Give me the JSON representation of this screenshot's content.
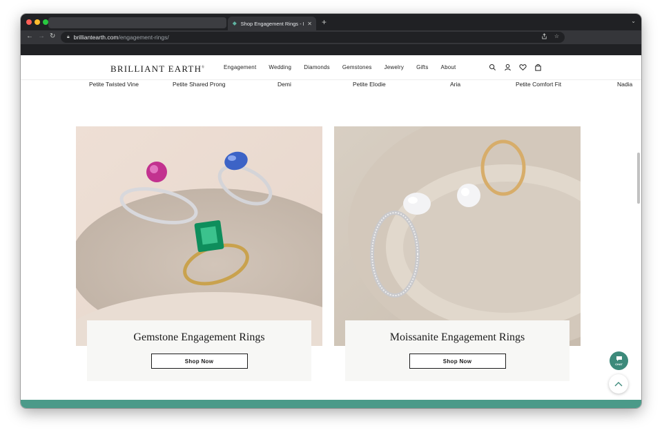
{
  "browser": {
    "tab_title": "Shop Engagement Rings - Eth",
    "url_host": "brilliantearth.com",
    "url_path": "/engagement-rings/"
  },
  "header": {
    "brand": "BRILLIANT EARTH",
    "brand_mark": "®",
    "nav": [
      "Engagement",
      "Wedding",
      "Diamonds",
      "Gemstones",
      "Jewelry",
      "Gifts",
      "About"
    ]
  },
  "styles_row": [
    "Petite Twisted Vine",
    "Petite Shared Prong",
    "Demi",
    "Petite Elodie",
    "Aria",
    "Petite Comfort Fit",
    "Nadia"
  ],
  "cards": [
    {
      "title": "Gemstone Engagement Rings",
      "button": "Shop Now"
    },
    {
      "title": "Moissanite Engagement Rings",
      "button": "Shop Now"
    }
  ],
  "chat": {
    "label": "CHAT"
  },
  "colors": {
    "accent": "#3d8a7b",
    "footer": "#4b9a89"
  }
}
